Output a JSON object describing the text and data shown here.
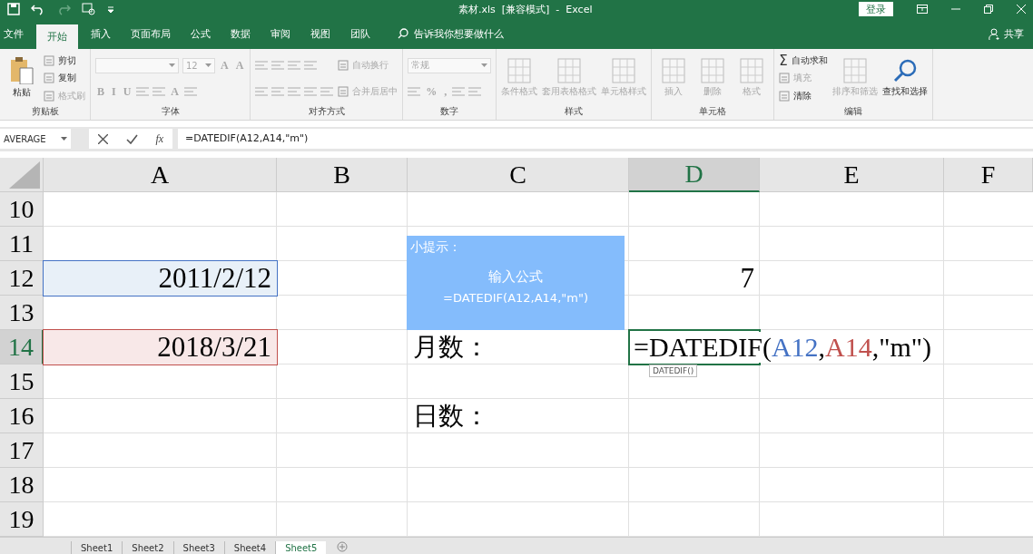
{
  "title_bar": {
    "title": "素材.xls  [兼容模式]  -  Excel",
    "login": "登录"
  },
  "menu_tabs": [
    {
      "label": "文件",
      "selected": false
    },
    {
      "label": "开始",
      "selected": true
    },
    {
      "label": "插入",
      "selected": false
    },
    {
      "label": "页面布局",
      "selected": false
    },
    {
      "label": "公式",
      "selected": false
    },
    {
      "label": "数据",
      "selected": false
    },
    {
      "label": "审阅",
      "selected": false
    },
    {
      "label": "视图",
      "selected": false
    },
    {
      "label": "团队",
      "selected": false
    }
  ],
  "tell_me": "告诉我你想要做什么",
  "share": "共享",
  "ribbon_groups": [
    {
      "label": "剪贴板",
      "columns": [
        {
          "rows": [
            [
              {
                "kind": "paste",
                "label": "粘贴",
                "disabled": false
              }
            ]
          ]
        },
        {
          "rows": [
            [
              {
                "kind": "small",
                "label": "剪切",
                "disabled": false
              }
            ],
            [
              {
                "kind": "small",
                "label": "复制",
                "disabled": false
              }
            ],
            [
              {
                "kind": "small",
                "label": "格式刷",
                "disabled": true
              }
            ]
          ]
        }
      ]
    },
    {
      "label": "字体",
      "columns": [
        {
          "rows": [
            [
              {
                "kind": "dropdown-wide",
                "disabled": true
              },
              {
                "kind": "dropdown",
                "value": "12",
                "disabled": true
              },
              {
                "kind": "glyph",
                "label": "A",
                "disabled": true
              },
              {
                "kind": "glyph",
                "label": "A",
                "disabled": true
              }
            ],
            [
              {
                "kind": "glyph",
                "label": "B",
                "disabled": true
              },
              {
                "kind": "glyph",
                "label": "I",
                "disabled": true
              },
              {
                "kind": "glyph",
                "label": "U",
                "disabled": true
              },
              {
                "kind": "icon",
                "disabled": true
              },
              {
                "kind": "icon",
                "disabled": true
              },
              {
                "kind": "glyph",
                "label": "A",
                "disabled": true
              },
              {
                "kind": "icon",
                "disabled": true
              }
            ]
          ]
        }
      ]
    },
    {
      "label": "对齐方式",
      "columns": [
        {
          "rows": [
            [
              {
                "kind": "icon",
                "disabled": true
              },
              {
                "kind": "icon",
                "disabled": true
              },
              {
                "kind": "icon",
                "disabled": true
              },
              {
                "kind": "icon",
                "disabled": true
              }
            ],
            [
              {
                "kind": "icon",
                "disabled": true
              },
              {
                "kind": "icon",
                "disabled": true
              },
              {
                "kind": "icon",
                "disabled": true
              },
              {
                "kind": "icon",
                "disabled": true
              },
              {
                "kind": "icon",
                "disabled": true
              }
            ]
          ]
        },
        {
          "rows": [
            [
              {
                "kind": "small",
                "label": "自动换行",
                "disabled": true
              }
            ],
            [
              {
                "kind": "small",
                "label": "合并后居中",
                "disabled": true
              }
            ]
          ]
        }
      ]
    },
    {
      "label": "数字",
      "columns": [
        {
          "rows": [
            [
              {
                "kind": "dropdown-wide",
                "value": "常规",
                "disabled": true
              }
            ],
            [
              {
                "kind": "icon",
                "disabled": true
              },
              {
                "kind": "glyph",
                "label": "%",
                "disabled": true
              },
              {
                "kind": "glyph",
                "label": ",",
                "disabled": true
              },
              {
                "kind": "icon",
                "disabled": true
              },
              {
                "kind": "icon",
                "disabled": true
              }
            ]
          ]
        }
      ]
    },
    {
      "label": "样式",
      "columns": [
        {
          "rows": [
            [
              {
                "kind": "large",
                "label": "条件格式",
                "disabled": true
              }
            ]
          ]
        },
        {
          "rows": [
            [
              {
                "kind": "large",
                "label": "套用表格格式",
                "disabled": true
              }
            ]
          ]
        },
        {
          "rows": [
            [
              {
                "kind": "large",
                "label": "单元格样式",
                "disabled": true
              }
            ]
          ]
        }
      ]
    },
    {
      "label": "单元格",
      "columns": [
        {
          "rows": [
            [
              {
                "kind": "large",
                "label": "插入",
                "disabled": true
              }
            ]
          ]
        },
        {
          "rows": [
            [
              {
                "kind": "large",
                "label": "删除",
                "disabled": true
              }
            ]
          ]
        },
        {
          "rows": [
            [
              {
                "kind": "large",
                "label": "格式",
                "disabled": true
              }
            ]
          ]
        }
      ]
    },
    {
      "label": "编辑",
      "columns": [
        {
          "rows": [
            [
              {
                "kind": "small",
                "symbol": "Σ",
                "label": "自动求和",
                "disabled": false
              }
            ],
            [
              {
                "kind": "small",
                "label": "填充",
                "disabled": true
              }
            ],
            [
              {
                "kind": "small",
                "label": "清除",
                "disabled": false
              }
            ]
          ]
        },
        {
          "rows": [
            [
              {
                "kind": "large",
                "label": "排序和筛选",
                "disabled": true
              }
            ]
          ]
        },
        {
          "rows": [
            [
              {
                "kind": "find",
                "label": "查找和选择",
                "disabled": false
              }
            ]
          ]
        }
      ]
    }
  ],
  "formula_bar": {
    "name_box": "AVERAGE",
    "fx": "fx",
    "formula": "=DATEDIF(A12,A14,\"m\")"
  },
  "columns": [
    {
      "label": "A",
      "selected": false
    },
    {
      "label": "B",
      "selected": false
    },
    {
      "label": "C",
      "selected": false
    },
    {
      "label": "D",
      "selected": true
    },
    {
      "label": "E",
      "selected": false
    },
    {
      "label": "F",
      "selected": false
    }
  ],
  "rows": [
    {
      "number": "10",
      "selected": false
    },
    {
      "number": "11",
      "selected": false
    },
    {
      "number": "12",
      "selected": false,
      "cells": {
        "col_a": {
          "kind": "ref-blue",
          "text": "2011/2/12"
        },
        "col_d": {
          "kind": "number",
          "text": "7"
        }
      }
    },
    {
      "number": "13",
      "selected": false
    },
    {
      "number": "14",
      "selected": true,
      "cells": {
        "col_a": {
          "kind": "ref-red",
          "text": "2018/3/21"
        },
        "col_c": {
          "kind": "label",
          "text": "月数："
        },
        "col_d": {
          "kind": "editing",
          "hint": "DATEDIF()",
          "parts": [
            {
              "text": "=DATEDIF(",
              "color": "#000000"
            },
            {
              "text": "A12",
              "color": "#4472c4"
            },
            {
              "text": ",",
              "color": "#000000"
            },
            {
              "text": "A14",
              "color": "#c0504d"
            },
            {
              "text": ",\"m\")",
              "color": "#000000"
            }
          ]
        }
      }
    },
    {
      "number": "15",
      "selected": false
    },
    {
      "number": "16",
      "selected": false,
      "cells": {
        "col_c": {
          "kind": "label",
          "text": "日数："
        }
      }
    },
    {
      "number": "17",
      "selected": false
    },
    {
      "number": "18",
      "selected": false
    },
    {
      "number": "19",
      "selected": false
    }
  ],
  "tip": {
    "title": "小提示：",
    "lines": [
      "输入公式",
      "=DATEDIF(A12,A14,\"m\")"
    ]
  },
  "sheet_tabs": [
    {
      "label": "Sheet1",
      "selected": false
    },
    {
      "label": "Sheet2",
      "selected": false
    },
    {
      "label": "Sheet3",
      "selected": false
    },
    {
      "label": "Sheet4",
      "selected": false
    },
    {
      "label": "Sheet5",
      "selected": true
    }
  ]
}
